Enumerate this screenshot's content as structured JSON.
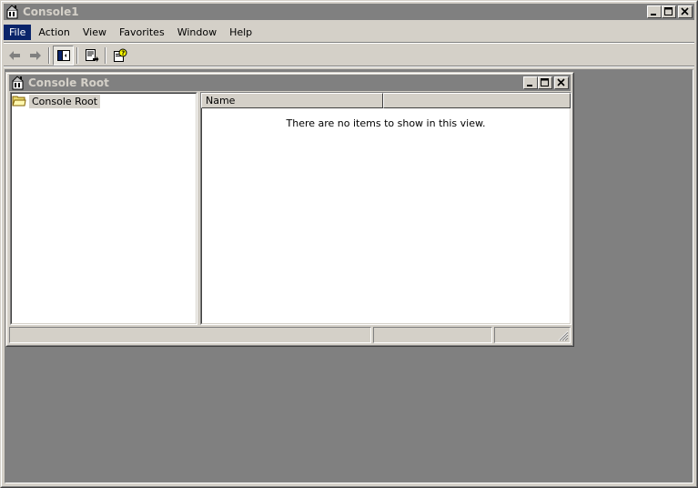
{
  "app": {
    "title": "Console1",
    "colors": {
      "face": "#d4d0c8",
      "inactive_title": "#808080",
      "menu_highlight": "#0a246a",
      "workspace": "#808080"
    }
  },
  "menubar": {
    "items": [
      {
        "label": "File",
        "active": true
      },
      {
        "label": "Action",
        "active": false
      },
      {
        "label": "View",
        "active": false
      },
      {
        "label": "Favorites",
        "active": false
      },
      {
        "label": "Window",
        "active": false
      },
      {
        "label": "Help",
        "active": false
      }
    ]
  },
  "toolbar": {
    "buttons": [
      {
        "icon": "back-arrow-icon",
        "enabled": false
      },
      {
        "icon": "forward-arrow-icon",
        "enabled": false
      },
      {
        "icon": "show-hide-console-tree-icon",
        "pressed": true
      },
      {
        "icon": "export-list-icon",
        "enabled": true
      },
      {
        "icon": "help-icon",
        "enabled": true
      }
    ]
  },
  "child_window": {
    "title": "Console Root",
    "tree": {
      "nodes": [
        {
          "label": "Console Root",
          "icon": "folder-icon",
          "selected": true
        }
      ]
    },
    "list": {
      "columns": [
        "Name"
      ],
      "empty_message": "There are no items to show in this view."
    }
  }
}
